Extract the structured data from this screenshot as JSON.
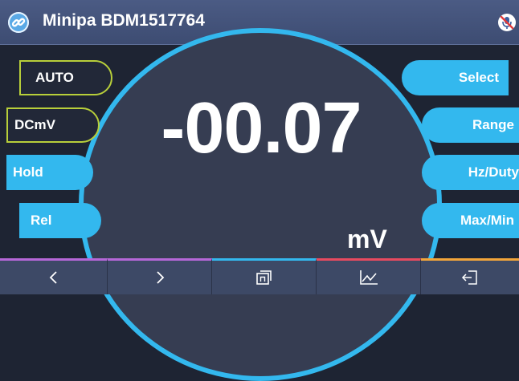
{
  "header": {
    "title": "Minipa BDM1517764",
    "app_icon": "link-icon",
    "status_icon": "mic-muted-icon"
  },
  "display": {
    "reading": "-00.07",
    "unit": "mV"
  },
  "left_buttons": [
    {
      "label": "AUTO",
      "style": "outline"
    },
    {
      "label": "DCmV",
      "style": "outline"
    },
    {
      "label": "Hold",
      "style": "filled"
    },
    {
      "label": "Rel",
      "style": "filled"
    }
  ],
  "right_buttons": [
    {
      "label": "Select"
    },
    {
      "label": "Range"
    },
    {
      "label": "Hz/Duty"
    },
    {
      "label": "Max/Min"
    }
  ],
  "bottom_bar": [
    {
      "icon": "chevron-left-icon",
      "accent": "#b667d8"
    },
    {
      "icon": "chevron-right-icon",
      "accent": "#b667d8"
    },
    {
      "icon": "window-stack-icon",
      "accent": "#33b8ee"
    },
    {
      "icon": "chart-line-icon",
      "accent": "#e84a5f"
    },
    {
      "icon": "exit-icon",
      "accent": "#f2a53a"
    }
  ],
  "colors": {
    "accent_blue": "#33b8ee",
    "outline_green": "#b8cf3a",
    "background": "#1e2433",
    "dial_face": "#363d52"
  }
}
